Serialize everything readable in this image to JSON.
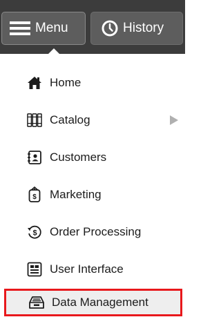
{
  "header": {
    "menu_label": "Menu",
    "history_label": "History",
    "menu_icon": "hamburger-icon",
    "history_icon": "clock-icon"
  },
  "menu": {
    "items": [
      {
        "label": "Home",
        "icon": "home-icon"
      },
      {
        "label": "Catalog",
        "icon": "catalog-icon",
        "has_submenu": true
      },
      {
        "label": "Customers",
        "icon": "customers-icon"
      },
      {
        "label": "Marketing",
        "icon": "marketing-icon"
      },
      {
        "label": "Order Processing",
        "icon": "order-processing-icon"
      },
      {
        "label": "User Interface",
        "icon": "user-interface-icon"
      },
      {
        "label": "Data Management",
        "icon": "data-management-icon",
        "selected": true
      }
    ]
  },
  "colors": {
    "header_bg": "#3c3c3c",
    "button_bg": "#5d5d5d",
    "selected_border": "#e8181c",
    "selected_bg": "#eeeeee"
  }
}
